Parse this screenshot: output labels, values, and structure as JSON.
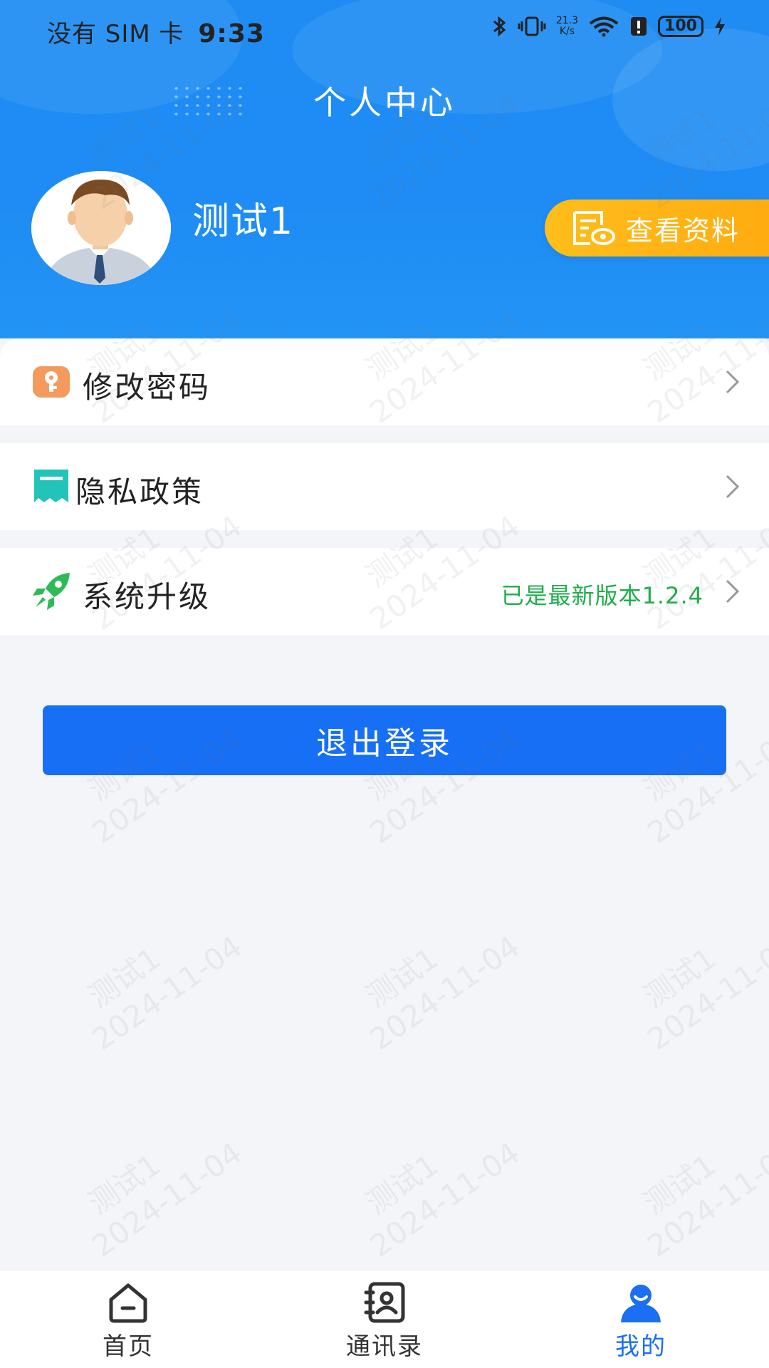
{
  "status_bar": {
    "carrier": "没有 SIM 卡",
    "time": "9:33",
    "net_speed_value": "21.3",
    "net_speed_unit": "K/s",
    "battery": "100"
  },
  "header": {
    "title": "个人中心",
    "username": "测试1",
    "view_profile_label": "查看资料"
  },
  "menu": [
    {
      "label": "修改密码",
      "icon": "key-icon",
      "value": ""
    },
    {
      "label": "隐私政策",
      "icon": "document-icon",
      "value": ""
    },
    {
      "label": "系统升级",
      "icon": "rocket-icon",
      "value": "已是最新版本1.2.4"
    }
  ],
  "logout_label": "退出登录",
  "watermark": {
    "line1": "测试1",
    "line2": "2024-11-04"
  },
  "tabbar": [
    {
      "label": "首页",
      "icon": "home-icon",
      "active": false
    },
    {
      "label": "通讯录",
      "icon": "contacts-icon",
      "active": false
    },
    {
      "label": "我的",
      "icon": "profile-icon",
      "active": true
    }
  ],
  "colors": {
    "header_blue": "#1f8cf3",
    "accent_orange": "#ffaa10",
    "logout_blue": "#176ff5",
    "version_green": "#1fad4a",
    "active_tab_blue": "#1a6ff2"
  }
}
